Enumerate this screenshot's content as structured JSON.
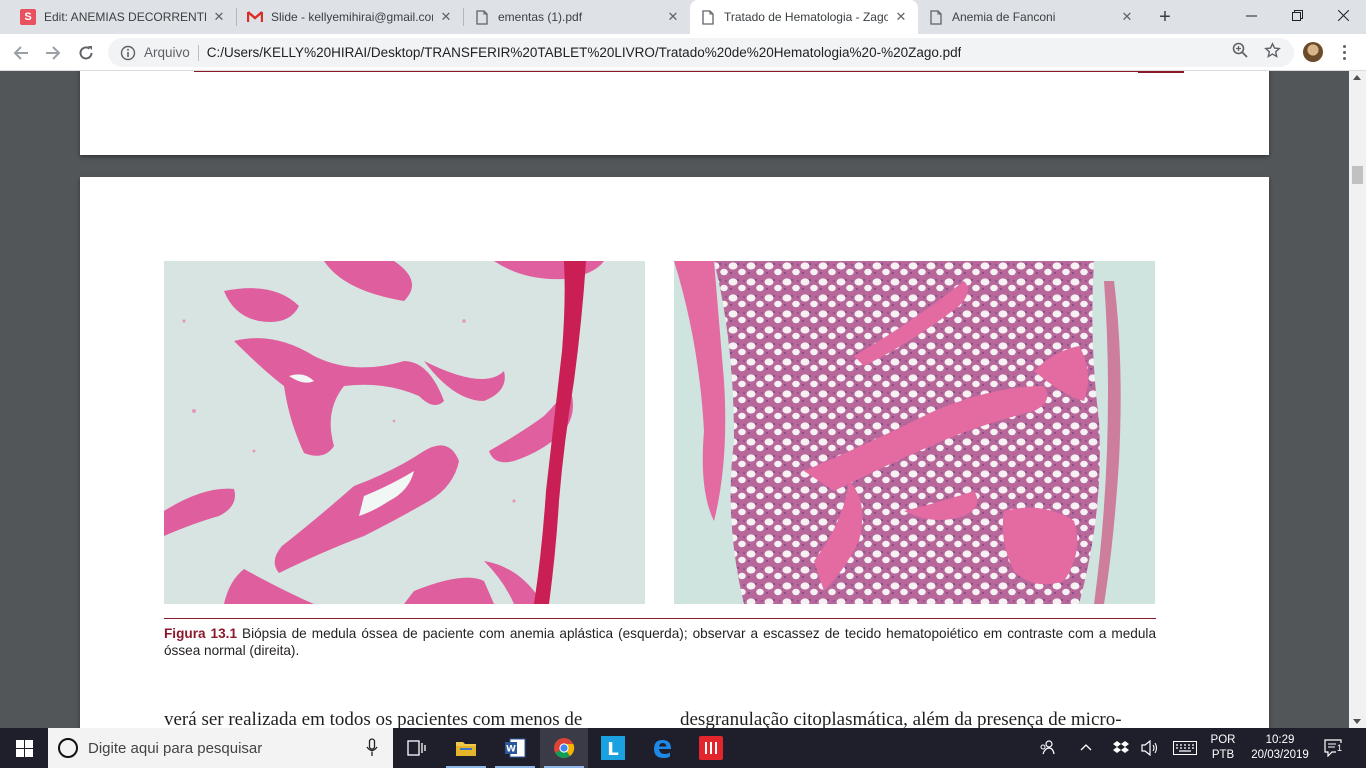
{
  "browser": {
    "tabs": [
      {
        "title": "Edit: ANEMIAS DECORRENTES",
        "favicon": "sway-icon",
        "active": false
      },
      {
        "title": "Slide - kellyemihirai@gmail.com",
        "favicon": "gmail-icon",
        "active": false
      },
      {
        "title": "ementas (1).pdf",
        "favicon": "document-icon",
        "active": false
      },
      {
        "title": "Tratado de Hematologia - Zago.pdf",
        "favicon": "document-icon",
        "active": true
      },
      {
        "title": "Anemia de Fanconi",
        "favicon": "document-icon",
        "active": false
      }
    ],
    "new_tab_label": "+",
    "address_bar": {
      "scheme_label": "Arquivo",
      "url": "C:/Users/KELLY%20HIRAI/Desktop/TRANSFERIR%20TABLET%20LIVRO/Tratado%20de%20Hematologia%20-%20Zago.pdf"
    }
  },
  "pdf": {
    "figure_caption_label": "Figura 13.1",
    "figure_caption_text": " Biópsia de medula óssea de paciente com anemia aplástica (esquerda); observar a escassez de tecido hematopoiético em contraste com a medula óssea normal (direita).",
    "body_left": "verá ser realizada em todos os pacientes com menos de",
    "body_right": "desgranulação citoplasmática, além da presença de micro-",
    "accent_color": "#8a1a2a"
  },
  "taskbar": {
    "search_placeholder": "Digite aqui para pesquisar",
    "language_top": "POR",
    "language_bottom": "PTB",
    "time": "10:29",
    "date": "20/03/2019",
    "notification_count": "1"
  }
}
